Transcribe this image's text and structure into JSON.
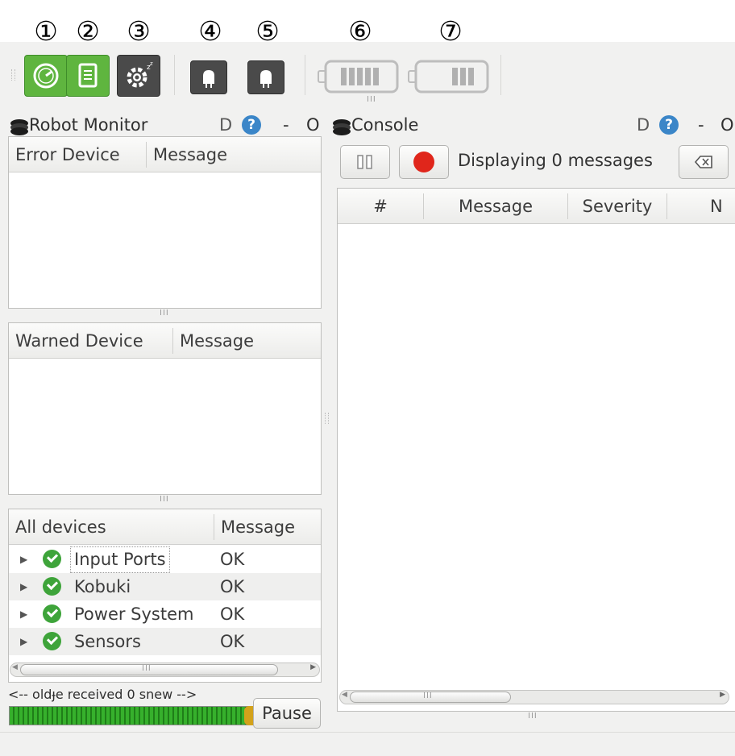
{
  "callouts": [
    "①",
    "②",
    "③",
    "④",
    "⑤",
    "⑥",
    "⑦"
  ],
  "icons": {
    "btn1": "speedometer-icon",
    "btn2": "notepad-icon",
    "btn3": "gear-sleep-icon",
    "btn4": "led-icon",
    "btn5": "led-icon",
    "btn6": "battery-full-icon",
    "btn7": "battery-partial-icon"
  },
  "colors": {
    "active_green": "#5fb53f",
    "record_red": "#e0261b",
    "progress_green": "#36b02c",
    "ok_green": "#3ea43a",
    "help_blue": "#3b86c8"
  },
  "robot_monitor": {
    "title": "Robot Monitor",
    "controls": {
      "d": "D",
      "help": "?",
      "minimize": "-",
      "close": "O"
    },
    "error_table": {
      "col1": "Error Device",
      "col2": "Message"
    },
    "warn_table": {
      "col1": "Warned Device",
      "col2": "Message"
    },
    "all_table": {
      "col1": "All devices",
      "col2": "Message",
      "rows": [
        {
          "name": "Input Ports",
          "message": "OK"
        },
        {
          "name": "Kobuki",
          "message": "OK"
        },
        {
          "name": "Power System",
          "message": "OK"
        },
        {
          "name": "Sensors",
          "message": "OK"
        }
      ]
    },
    "timeline_text": "<-- oldɟe received 0 snew -->",
    "pause_label": "Pause"
  },
  "console": {
    "title": "Console",
    "controls": {
      "d": "D",
      "help": "?",
      "minimize": "-",
      "close": "O"
    },
    "status": "Displaying 0 messages",
    "columns": [
      "#",
      "Message",
      "Severity",
      "N"
    ]
  },
  "grip_text": "III"
}
